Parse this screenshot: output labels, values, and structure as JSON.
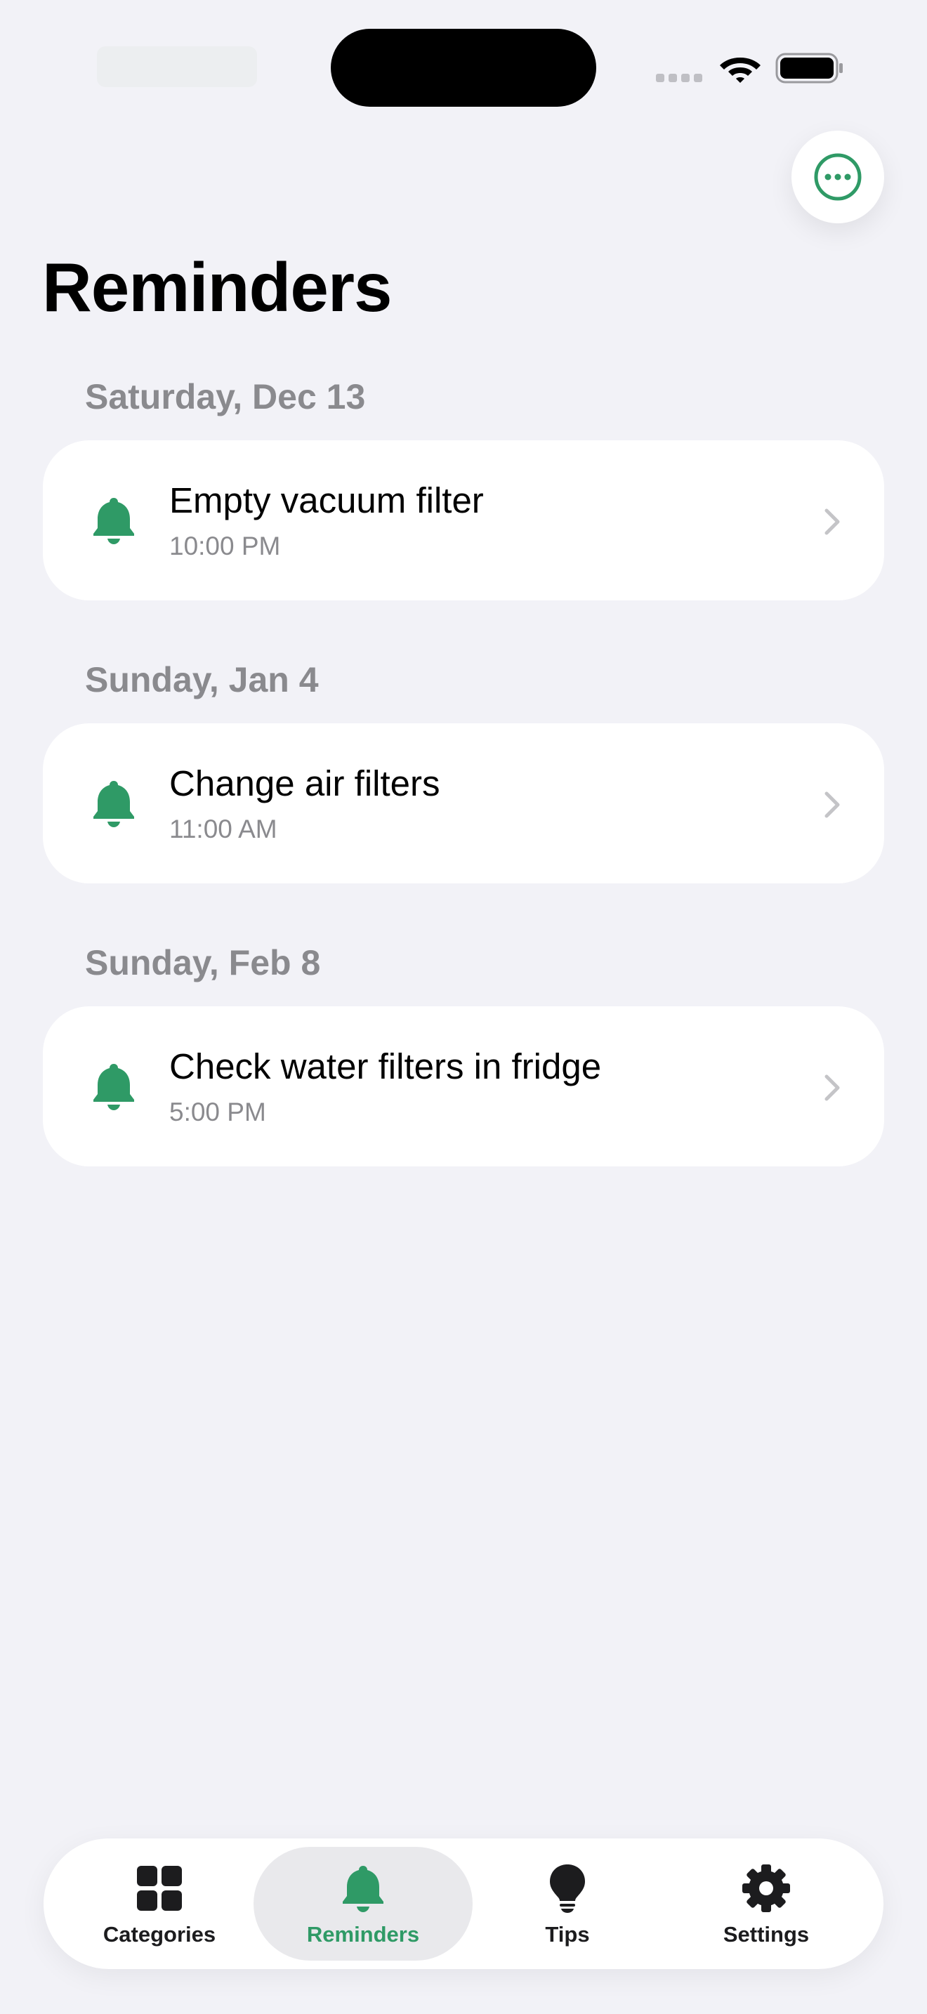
{
  "colors": {
    "accent": "#2f9a66",
    "background": "#f2f2f7",
    "card": "#ffffff",
    "secondary_text": "#8a8a8e"
  },
  "header": {
    "title": "Reminders",
    "more_icon": "ellipsis-circle-icon"
  },
  "reminders": [
    {
      "date": "Saturday, Dec 13",
      "title": "Empty vacuum filter",
      "time": "10:00 PM",
      "icon": "bell-icon"
    },
    {
      "date": "Sunday, Jan 4",
      "title": "Change air filters",
      "time": "11:00 AM",
      "icon": "bell-icon"
    },
    {
      "date": "Sunday, Feb 8",
      "title": "Check water filters in fridge",
      "time": "5:00 PM",
      "icon": "bell-icon"
    }
  ],
  "tab_bar": {
    "active": "Reminders",
    "tabs": [
      {
        "label": "Categories",
        "icon": "grid-icon"
      },
      {
        "label": "Reminders",
        "icon": "bell-icon"
      },
      {
        "label": "Tips",
        "icon": "lightbulb-icon"
      },
      {
        "label": "Settings",
        "icon": "gear-icon"
      }
    ]
  }
}
